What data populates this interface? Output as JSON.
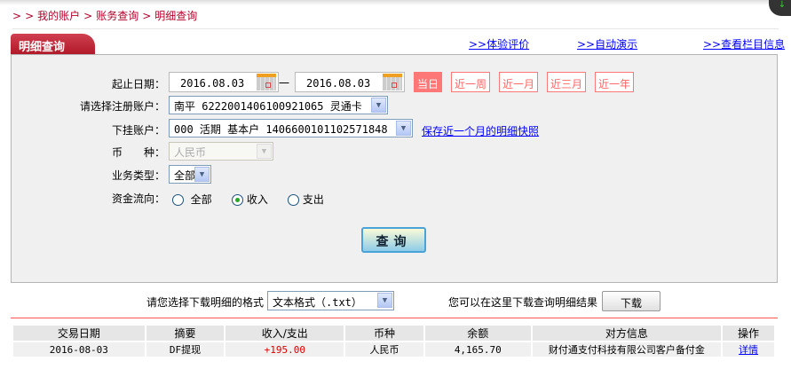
{
  "breadcrumb": [
    ">",
    ">",
    "我的账户",
    ">",
    "账务查询",
    ">",
    "明细查询"
  ],
  "tab": {
    "title": "明细查询"
  },
  "top_links": [
    ">>体验评价",
    ">>自动演示",
    ">>查看栏目信息"
  ],
  "form": {
    "date_label": "起止日期：",
    "start_date": "2016.08.03",
    "dash": "一",
    "end_date": "2016.08.03",
    "quick_ranges": [
      "当日",
      "近一周",
      "近一月",
      "近三月",
      "近一年"
    ],
    "quick_selected": "当日",
    "reg_account_label": "请选择注册账户：",
    "reg_account_value": "南平 6222001406100921065 灵通卡",
    "sub_account_label": "下挂账户：",
    "sub_account_value": "000 活期 基本户 1406600101102571848",
    "snapshot_link": "保存近一个月的明细快照",
    "currency_label": "币　　种：",
    "currency_value": "人民币",
    "biz_type_label": "业务类型：",
    "biz_type_value": "全部",
    "flow_label": "资金流向：",
    "flow_options": [
      "全部",
      "收入",
      "支出"
    ],
    "flow_selected": "收入",
    "query_button": "查询"
  },
  "download": {
    "format_label": "请您选择下载明细的格式",
    "format_value": "文本格式（.txt）",
    "hint": "您可以在这里下载查询明细结果",
    "button": "下载"
  },
  "table": {
    "headers": [
      "交易日期",
      "摘要",
      "收入/支出",
      "币种",
      "余额",
      "对方信息",
      "操作"
    ],
    "rows": [
      [
        "2016-08-03",
        "DF提现",
        "+195.00",
        "人民币",
        "4,165.70",
        "财付通支付科技有限公司客户备付金",
        "详情"
      ]
    ]
  },
  "colors": {
    "brand": "#b5002a",
    "link": "#0000ff",
    "quick_active": "#ff7777",
    "income": "#dd0000"
  }
}
